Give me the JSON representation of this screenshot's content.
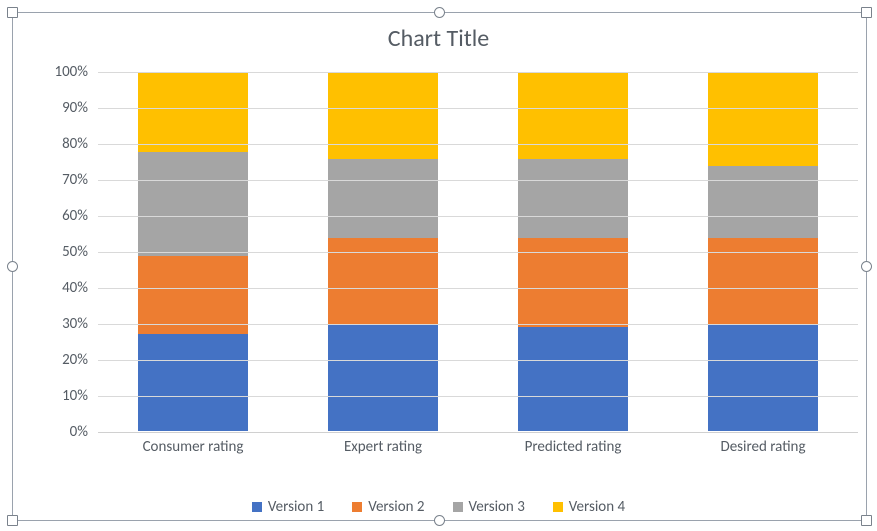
{
  "chart_data": {
    "type": "bar",
    "stacked": "percent",
    "title": "Chart Title",
    "xlabel": "",
    "ylabel": "",
    "ylim": [
      0,
      100
    ],
    "categories": [
      "Consumer rating",
      "Expert rating",
      "Predicted rating",
      "Desired rating"
    ],
    "series": [
      {
        "name": "Version 1",
        "color": "#4472C4",
        "values": [
          27,
          30,
          29,
          30
        ]
      },
      {
        "name": "Version 2",
        "color": "#ED7D31",
        "values": [
          22,
          24,
          25,
          24
        ]
      },
      {
        "name": "Version 3",
        "color": "#A5A5A5",
        "values": [
          29,
          22,
          22,
          20
        ]
      },
      {
        "name": "Version 4",
        "color": "#FFC000",
        "values": [
          22,
          24,
          24,
          26
        ]
      }
    ],
    "y_ticks": [
      "0%",
      "10%",
      "20%",
      "30%",
      "40%",
      "50%",
      "60%",
      "70%",
      "80%",
      "90%",
      "100%"
    ]
  },
  "legend": {
    "items": [
      "Version 1",
      "Version 2",
      "Version 3",
      "Version 4"
    ]
  }
}
